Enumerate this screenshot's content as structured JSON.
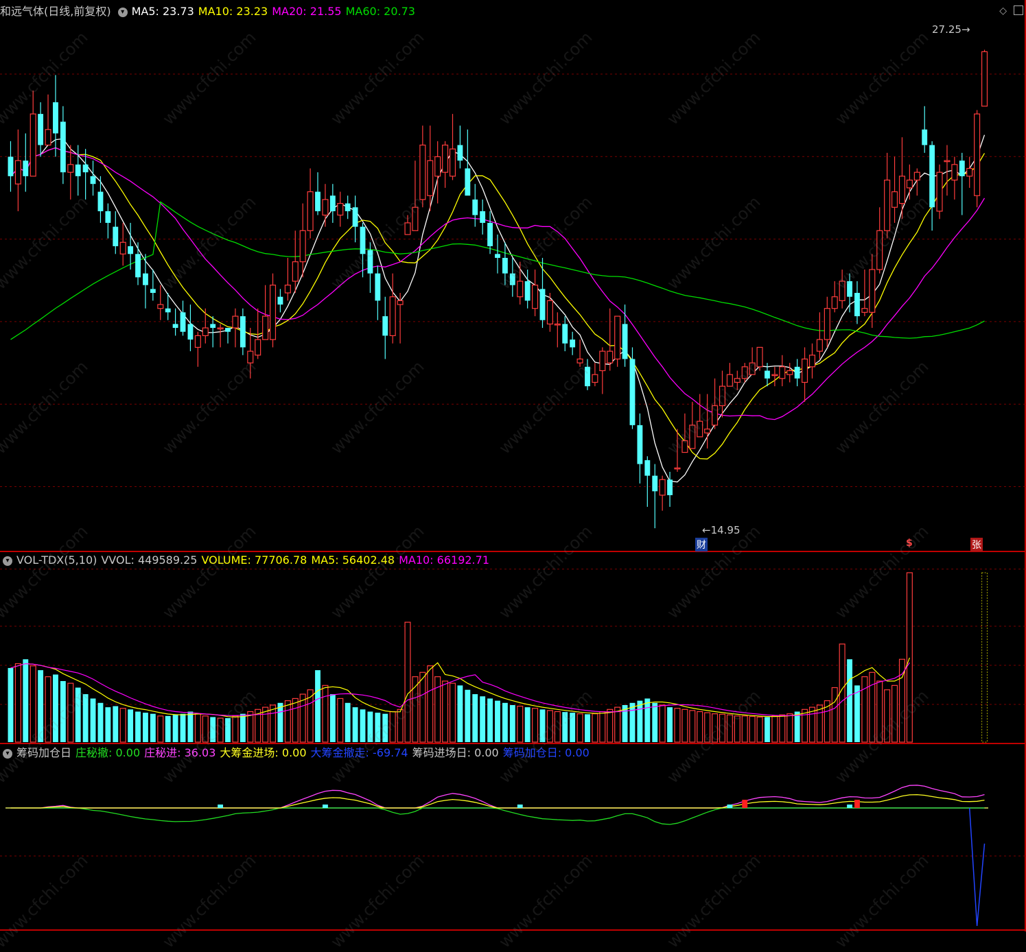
{
  "colors": {
    "bg": "#000000",
    "up": "#ff3c3c",
    "down": "#54ffff",
    "grid": "#7a0000",
    "ma5": "#ffffff",
    "ma10": "#ffff00",
    "ma20": "#ff00ff",
    "ma60": "#00dd00",
    "divider": "#c00000",
    "blue": "#2244ff",
    "green": "#22dd22",
    "magenta": "#ff44ff",
    "yellow": "#ffff22"
  },
  "main_header": {
    "stock": "和远气体(日线,前复权)",
    "ma5": "MA5: 23.73",
    "ma10": "MA10: 23.23",
    "ma20": "MA20: 21.55",
    "ma60": "MA60: 20.73"
  },
  "vol_header": {
    "name": "VOL-TDX(5,10)",
    "vvol": "VVOL: 449589.25",
    "volume": "VOLUME: 77706.78",
    "ma5": "MA5: 56402.48",
    "ma10": "MA10: 66192.71"
  },
  "ind_header": {
    "name": "筹码加仓日",
    "a": "庄秘撤: 0.00",
    "b": "庄秘进: 36.03",
    "c": "大筹金进场: 0.00",
    "d": "大筹金撤走: -69.74",
    "e": "筹码进场日: 0.00",
    "f": "筹码加仓日: 0.00"
  },
  "annotations": {
    "high": "27.25",
    "low": "←14.95",
    "tag_cai": "财",
    "tag_s": "$",
    "tag_zhang": "张"
  },
  "watermark": "www.cfchi.com",
  "chart_data": [
    {
      "type": "candlestick",
      "title": "和远气体(日线,前复权)",
      "ylim": [
        14.6,
        28.0
      ],
      "high": 27.25,
      "low": 14.95,
      "candles": [
        [
          24.5,
          24.0,
          24.9,
          23.6
        ],
        [
          23.8,
          24.4,
          25.2,
          23.1
        ],
        [
          24.4,
          24.0,
          25.1,
          23.6
        ],
        [
          24.0,
          25.6,
          26.2,
          24.2
        ],
        [
          25.6,
          24.8,
          25.9,
          24.5
        ],
        [
          24.8,
          25.2,
          26.1,
          24.9
        ],
        [
          25.9,
          25.1,
          26.6,
          24.5
        ],
        [
          25.4,
          24.1,
          25.8,
          23.8
        ],
        [
          24.1,
          24.3,
          24.8,
          23.4
        ],
        [
          24.3,
          24.0,
          24.8,
          23.5
        ],
        [
          24.3,
          24.1,
          24.7,
          23.4
        ],
        [
          24.0,
          23.8,
          24.4,
          23.5
        ],
        [
          23.6,
          23.1,
          24.0,
          22.8
        ],
        [
          23.1,
          22.8,
          23.3,
          22.4
        ],
        [
          22.7,
          22.2,
          23.1,
          22.0
        ],
        [
          22.0,
          22.3,
          22.8,
          21.7
        ],
        [
          22.2,
          22.0,
          22.8,
          21.6
        ],
        [
          22.0,
          21.4,
          22.3,
          21.2
        ],
        [
          21.5,
          21.2,
          22.0,
          20.6
        ],
        [
          21.1,
          21.0,
          21.6,
          20.8
        ],
        [
          20.6,
          20.7,
          21.2,
          20.3
        ],
        [
          20.6,
          20.5,
          21.0,
          20.3
        ],
        [
          20.2,
          20.1,
          20.6,
          19.9
        ],
        [
          20.5,
          20.0,
          20.8,
          19.9
        ],
        [
          20.2,
          19.8,
          20.7,
          19.5
        ],
        [
          19.6,
          19.9,
          20.0,
          19.1
        ],
        [
          19.9,
          20.1,
          20.6,
          19.7
        ],
        [
          20.2,
          20.1,
          20.4,
          19.6
        ],
        [
          20.1,
          20.1,
          20.2,
          19.6
        ],
        [
          20.1,
          20.0,
          20.1,
          19.7
        ],
        [
          20.1,
          20.4,
          20.6,
          19.6
        ],
        [
          20.4,
          19.6,
          20.6,
          19.4
        ],
        [
          19.2,
          19.5,
          20.1,
          18.8
        ],
        [
          19.4,
          19.8,
          20.6,
          19.3
        ],
        [
          19.8,
          20.4,
          21.2,
          20.0
        ],
        [
          19.8,
          21.2,
          21.5,
          19.6
        ],
        [
          20.9,
          20.7,
          21.1,
          20.5
        ],
        [
          21.0,
          21.2,
          21.9,
          20.8
        ],
        [
          21.3,
          21.8,
          22.6,
          21.0
        ],
        [
          21.8,
          22.6,
          23.3,
          21.4
        ],
        [
          22.6,
          23.6,
          24.2,
          22.4
        ],
        [
          23.6,
          23.1,
          24.1,
          23.0
        ],
        [
          23.0,
          23.4,
          23.8,
          22.7
        ],
        [
          23.5,
          23.1,
          23.8,
          22.8
        ],
        [
          23.0,
          23.3,
          23.6,
          22.7
        ],
        [
          23.3,
          23.1,
          23.5,
          22.9
        ],
        [
          23.2,
          22.7,
          23.5,
          22.3
        ],
        [
          22.7,
          22.0,
          22.8,
          21.4
        ],
        [
          22.1,
          21.5,
          22.3,
          21.0
        ],
        [
          21.5,
          20.8,
          21.7,
          20.3
        ],
        [
          20.4,
          19.9,
          20.9,
          19.3
        ],
        [
          19.9,
          20.9,
          21.5,
          19.7
        ],
        [
          20.7,
          20.8,
          21.0,
          19.7
        ],
        [
          22.5,
          22.8,
          23.0,
          22.5
        ],
        [
          22.6,
          23.2,
          24.4,
          22.8
        ],
        [
          23.4,
          24.8,
          25.3,
          23.2
        ],
        [
          23.5,
          24.4,
          25.3,
          23.1
        ],
        [
          24.0,
          24.5,
          24.9,
          23.3
        ],
        [
          24.1,
          24.8,
          24.9,
          23.7
        ],
        [
          24.0,
          24.7,
          25.6,
          23.9
        ],
        [
          24.8,
          24.4,
          25.3,
          24.2
        ],
        [
          24.2,
          23.5,
          25.2,
          23.8
        ],
        [
          23.4,
          23.0,
          23.8,
          22.7
        ],
        [
          23.1,
          22.8,
          23.4,
          22.5
        ],
        [
          22.8,
          22.2,
          23.1,
          22.0
        ],
        [
          22.0,
          21.9,
          22.5,
          21.5
        ],
        [
          21.9,
          21.5,
          22.3,
          21.2
        ],
        [
          21.5,
          21.2,
          21.9,
          20.9
        ],
        [
          20.9,
          21.3,
          21.8,
          20.7
        ],
        [
          21.3,
          20.8,
          21.6,
          20.6
        ],
        [
          20.6,
          21.2,
          21.6,
          20.4
        ],
        [
          21.1,
          20.3,
          21.9,
          20.1
        ],
        [
          20.2,
          20.8,
          21.0,
          20.0
        ],
        [
          20.2,
          20.2,
          20.5,
          19.6
        ],
        [
          20.2,
          19.7,
          20.4,
          19.5
        ],
        [
          19.8,
          19.6,
          20.0,
          19.4
        ],
        [
          19.2,
          19.3,
          19.8,
          19.1
        ],
        [
          19.1,
          18.6,
          19.3,
          18.5
        ],
        [
          18.7,
          18.9,
          19.2,
          18.6
        ],
        [
          19.0,
          19.5,
          19.6,
          18.4
        ],
        [
          19.2,
          19.5,
          20.6,
          19.0
        ],
        [
          19.3,
          20.4,
          20.3,
          19.1
        ],
        [
          20.2,
          19.3,
          20.7,
          19.1
        ],
        [
          19.3,
          17.6,
          19.6,
          17.5
        ],
        [
          17.6,
          16.6,
          17.9,
          16.1
        ],
        [
          16.7,
          16.3,
          16.8,
          15.5
        ],
        [
          16.3,
          15.9,
          16.6,
          14.95
        ],
        [
          15.8,
          16.2,
          16.3,
          15.4
        ],
        [
          16.2,
          15.8,
          16.4,
          15.5
        ],
        [
          16.5,
          16.5,
          17.5,
          16.4
        ],
        [
          16.9,
          17.2,
          17.9,
          16.9
        ],
        [
          17.0,
          17.6,
          18.2,
          17.1
        ],
        [
          17.3,
          17.7,
          18.4,
          17.3
        ],
        [
          17.4,
          17.5,
          18.4,
          17.0
        ],
        [
          17.6,
          18.1,
          18.8,
          17.5
        ],
        [
          18.1,
          18.6,
          19.0,
          17.8
        ],
        [
          18.6,
          18.9,
          19.2,
          18.6
        ],
        [
          18.7,
          18.8,
          19.0,
          18.5
        ],
        [
          18.8,
          19.1,
          19.2,
          18.7
        ],
        [
          18.9,
          19.2,
          19.6,
          19.0
        ],
        [
          19.1,
          19.6,
          19.5,
          19.0
        ],
        [
          19.0,
          18.8,
          19.2,
          18.6
        ],
        [
          18.9,
          18.9,
          19.1,
          18.6
        ],
        [
          18.8,
          19.1,
          19.4,
          18.6
        ],
        [
          18.9,
          19.0,
          19.2,
          18.7
        ],
        [
          19.1,
          18.8,
          19.3,
          18.6
        ],
        [
          18.7,
          19.3,
          19.6,
          18.2
        ],
        [
          19.1,
          19.4,
          19.7,
          18.8
        ],
        [
          19.5,
          19.8,
          20.5,
          19.3
        ],
        [
          19.8,
          20.6,
          20.9,
          19.6
        ],
        [
          20.6,
          20.9,
          21.3,
          20.5
        ],
        [
          20.8,
          21.3,
          21.6,
          20.6
        ],
        [
          21.3,
          20.9,
          21.5,
          20.5
        ],
        [
          21.0,
          20.4,
          21.3,
          20.2
        ],
        [
          20.5,
          20.6,
          21.6,
          20.4
        ],
        [
          20.5,
          21.6,
          22.0,
          20.1
        ],
        [
          21.6,
          22.6,
          23.2,
          21.5
        ],
        [
          22.6,
          23.9,
          24.6,
          22.4
        ],
        [
          23.2,
          23.6,
          24.5,
          22.8
        ],
        [
          23.3,
          24.0,
          25.0,
          22.9
        ],
        [
          23.7,
          23.9,
          24.3,
          23.4
        ],
        [
          23.9,
          24.1,
          24.2,
          23.5
        ],
        [
          25.2,
          24.8,
          25.8,
          24.6
        ],
        [
          24.8,
          23.2,
          24.9,
          22.6
        ],
        [
          23.1,
          24.1,
          24.3,
          22.9
        ],
        [
          24.4,
          24.4,
          24.8,
          23.5
        ],
        [
          23.9,
          24.3,
          24.5,
          23.4
        ],
        [
          24.4,
          24.0,
          24.6,
          23.0
        ],
        [
          24.0,
          24.2,
          24.5,
          23.7
        ],
        [
          23.5,
          25.6,
          25.7,
          23.2
        ],
        [
          25.8,
          27.2,
          27.25,
          25.8
        ]
      ],
      "ma60_note": "slow moving average, flat near 20.7 on the right",
      "tags": [
        {
          "label": "财",
          "index": 85
        },
        {
          "label": "$",
          "index": 111
        },
        {
          "label": "张",
          "index": 120
        }
      ]
    },
    {
      "type": "bar",
      "title": "VOL-TDX(5,10)",
      "series": [
        {
          "name": "VOLUME",
          "values": [
            34000,
            36000,
            38000,
            35000,
            33000,
            30000,
            31000,
            28000,
            27000,
            25000,
            22000,
            20000,
            18000,
            16000,
            16500,
            15500,
            15000,
            14000,
            13500,
            13000,
            12000,
            12000,
            12500,
            13000,
            14000,
            13000,
            12000,
            11500,
            11000,
            11000,
            12000,
            13000,
            14000,
            15000,
            16000,
            17000,
            18000,
            19000,
            20000,
            22000,
            24000,
            33000,
            26000,
            22000,
            20000,
            18000,
            16000,
            15000,
            14000,
            13500,
            13000,
            14000,
            15000,
            55000,
            30000,
            32000,
            35000,
            30000,
            28000,
            27000,
            26000,
            24000,
            22000,
            21000,
            20000,
            19000,
            18000,
            17000,
            16500,
            16000,
            15500,
            15000,
            14500,
            14000,
            13800,
            13500,
            13000,
            12800,
            13000,
            14000,
            15000,
            16000,
            17000,
            18000,
            19000,
            20000,
            18000,
            17000,
            16000,
            15500,
            15000,
            14500,
            14000,
            13500,
            13000,
            12800,
            12500,
            12000,
            12000,
            11800,
            11500,
            11500,
            12000,
            12500,
            13000,
            14000,
            15000,
            16000,
            17000,
            19000,
            25000,
            45000,
            38000,
            26000,
            30000,
            32000,
            28000,
            24000,
            26000,
            38000,
            77706.78
          ]
        }
      ]
    },
    {
      "type": "line",
      "title": "筹码加仓日",
      "series_names": [
        "庄秘撤",
        "庄秘进",
        "大筹金进场",
        "大筹金撤走",
        "筹码进场日",
        "筹码加仓日"
      ]
    }
  ]
}
